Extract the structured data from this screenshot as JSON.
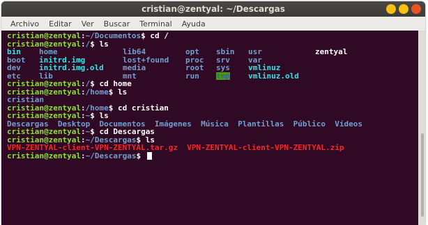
{
  "window": {
    "title": "cristian@zentyal: ~/Descargas",
    "controls": [
      {
        "name": "minimize-button",
        "color": "#f5c211"
      },
      {
        "name": "maximize-button",
        "color": "#f5c211"
      },
      {
        "name": "close-button",
        "color": "#e95420"
      }
    ]
  },
  "menu": [
    "Archivo",
    "Editar",
    "Ver",
    "Buscar",
    "Terminal",
    "Ayuda"
  ],
  "colors": {
    "background": "#300a24",
    "prompt_user": "#8ae234",
    "prompt_path": "#729fcf",
    "directory": "#729fcf",
    "symlink": "#34e2e2",
    "archive": "#ef2929"
  },
  "terminal": {
    "lines": [
      {
        "user": "cristian@zentyal",
        "path": "~/Documentos",
        "cmd": "$ cd /"
      },
      {
        "user": "cristian@zentyal",
        "path": "/",
        "cmd": "$ ls"
      },
      {
        "ls": [
          [
            {
              "t": "bin",
              "c": "link"
            },
            {
              "t": "home",
              "c": "dir"
            },
            {
              "t": "lib64",
              "c": "dir"
            },
            {
              "t": "opt",
              "c": "dir"
            },
            {
              "t": "sbin",
              "c": "dir"
            },
            {
              "t": "usr",
              "c": "dir"
            },
            {
              "t": "zentyal",
              "c": "cmd"
            }
          ],
          [
            {
              "t": "boot",
              "c": "dir"
            },
            {
              "t": "initrd.img",
              "c": "link"
            },
            {
              "t": "lost+found",
              "c": "dir"
            },
            {
              "t": "proc",
              "c": "dir"
            },
            {
              "t": "srv",
              "c": "dir"
            },
            {
              "t": "var",
              "c": "dir"
            },
            {
              "t": "",
              "c": "dir"
            }
          ],
          [
            {
              "t": "dev",
              "c": "dir"
            },
            {
              "t": "initrd.img.old",
              "c": "link"
            },
            {
              "t": "media",
              "c": "dir"
            },
            {
              "t": "root",
              "c": "dir"
            },
            {
              "t": "sys",
              "c": "dir"
            },
            {
              "t": "vmlinuz",
              "c": "link"
            },
            {
              "t": "",
              "c": "dir"
            }
          ],
          [
            {
              "t": "etc",
              "c": "dir"
            },
            {
              "t": "lib",
              "c": "dir"
            },
            {
              "t": "mnt",
              "c": "dir"
            },
            {
              "t": "run",
              "c": "dir"
            },
            {
              "t": "tmp",
              "c": "tmp"
            },
            {
              "t": "vmlinuz.old",
              "c": "link"
            },
            {
              "t": "",
              "c": "dir"
            }
          ]
        ]
      },
      {
        "user": "cristian@zentyal",
        "path": "/",
        "cmd": "$ cd home"
      },
      {
        "user": "cristian@zentyal",
        "path": "/home",
        "cmd": "$ ls"
      },
      {
        "plain": [
          {
            "t": "cristian",
            "c": "dir"
          }
        ]
      },
      {
        "user": "cristian@zentyal",
        "path": "/home",
        "cmd": "$ cd cristian"
      },
      {
        "user": "cristian@zentyal",
        "path": "~",
        "cmd": "$ ls"
      },
      {
        "plain": [
          {
            "t": "Descargas  Desktop  Documentos  Imágenes  Música  Plantillas  Público  Vídeos",
            "c": "dir"
          }
        ]
      },
      {
        "user": "cristian@zentyal",
        "path": "~",
        "cmd": "$ cd Descargas"
      },
      {
        "user": "cristian@zentyal",
        "path": "~/Descargas",
        "cmd": "$ ls"
      },
      {
        "plain": [
          {
            "t": "VPN-ZENTYAL-client-VPN-ZENTYAL.tar.gz  VPN-ZENTYAL-client-VPN-ZENTYAL.zip",
            "c": "red"
          }
        ]
      },
      {
        "user": "cristian@zentyal",
        "path": "~/Descargas",
        "cmd": "$ ",
        "cursor": true
      }
    ]
  }
}
